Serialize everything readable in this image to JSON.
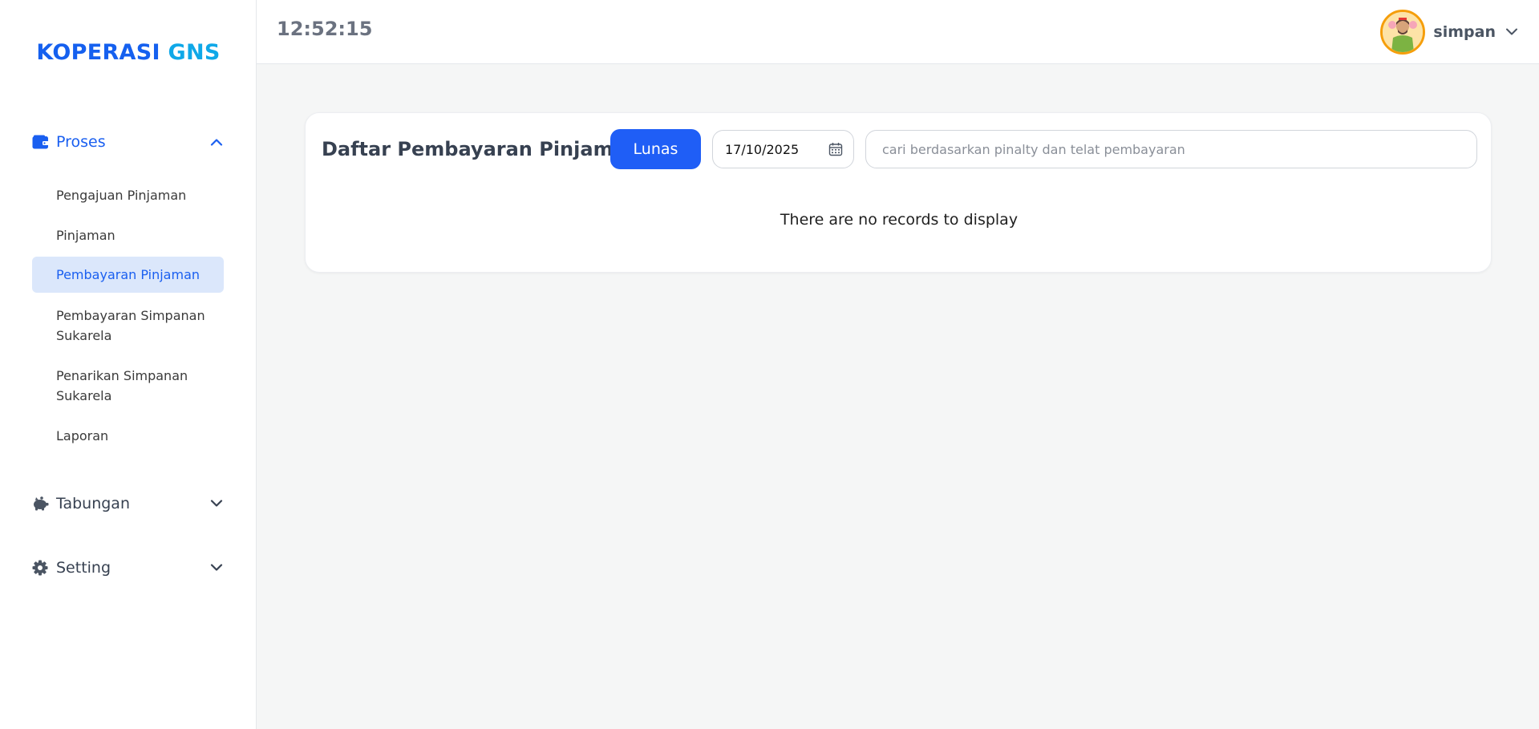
{
  "brand": {
    "part1": "KOPERASI ",
    "part2": "GNS"
  },
  "sidebar": {
    "groups": [
      {
        "label": "Proses",
        "icon": "wallet-icon",
        "state": "expanded",
        "items": [
          {
            "label": "Pengajuan Pinjaman"
          },
          {
            "label": "Pinjaman"
          },
          {
            "label": "Pembayaran Pinjaman",
            "selected": true
          },
          {
            "label": "Pembayaran Simpanan Sukarela"
          },
          {
            "label": "Penarikan Simpanan Sukarela"
          },
          {
            "label": "Laporan"
          }
        ]
      },
      {
        "label": "Tabungan",
        "icon": "piggy-bank-icon",
        "state": "collapsed"
      },
      {
        "label": "Setting",
        "icon": "gear-icon",
        "state": "collapsed"
      }
    ]
  },
  "header": {
    "clock": "12:52:15",
    "user": {
      "name": "simpan"
    }
  },
  "main": {
    "title": "Daftar Pembayaran Pinjaman",
    "lunas_button": "Lunas",
    "date_value": "17/10/2025",
    "search_placeholder": "cari berdasarkan pinalty dan telat pembayaran",
    "empty_message": "There are no records to display"
  },
  "colors": {
    "primary": "#1f5ef6",
    "brand_blue": "#1560ef",
    "brand_cyan": "#0fa8e8",
    "selected_bg": "#dbe7fb",
    "page_bg": "#f5f6f6"
  }
}
